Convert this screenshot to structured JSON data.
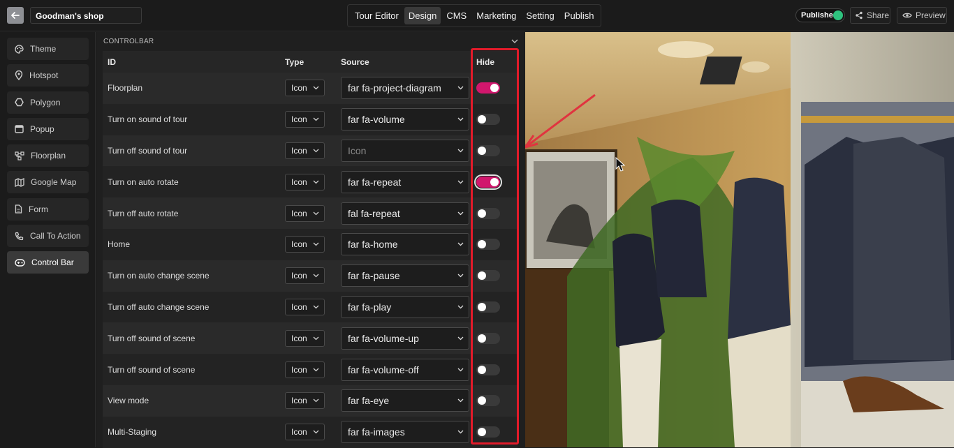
{
  "header": {
    "shop_name": "Goodman's shop",
    "nav": [
      "Tour Editor",
      "Design",
      "CMS",
      "Marketing",
      "Setting",
      "Publish"
    ],
    "active_nav": "Design",
    "published_label": "Published",
    "share_label": "Share",
    "preview_label": "Preview",
    "status_color": "#2ec27e"
  },
  "sidebar": {
    "items": [
      {
        "label": "Theme",
        "icon": "palette-icon"
      },
      {
        "label": "Hotspot",
        "icon": "map-pin-icon"
      },
      {
        "label": "Polygon",
        "icon": "hexagon-icon"
      },
      {
        "label": "Popup",
        "icon": "window-icon"
      },
      {
        "label": "Floorplan",
        "icon": "diagram-icon"
      },
      {
        "label": "Google Map",
        "icon": "map-icon"
      },
      {
        "label": "Form",
        "icon": "document-icon"
      },
      {
        "label": "Call To Action",
        "icon": "phone-icon"
      },
      {
        "label": "Control Bar",
        "icon": "gamepad-icon"
      }
    ],
    "active": "Control Bar"
  },
  "panel": {
    "title": "CONTROLBAR",
    "columns": {
      "id": "ID",
      "type": "Type",
      "source": "Source",
      "hide": "Hide"
    },
    "rows": [
      {
        "id": "Floorplan",
        "type": "Icon",
        "source": "far fa-project-diagram",
        "hide": true
      },
      {
        "id": "Turn on sound of tour",
        "type": "Icon",
        "source": "far fa-volume",
        "hide": false
      },
      {
        "id": "Turn off sound of tour",
        "type": "Icon",
        "source": "Icon",
        "hide": false,
        "placeholder": true
      },
      {
        "id": "Turn on auto rotate",
        "type": "Icon",
        "source": "far fa-repeat",
        "hide": true
      },
      {
        "id": "Turn off auto rotate",
        "type": "Icon",
        "source": "fal fa-repeat",
        "hide": false
      },
      {
        "id": "Home",
        "type": "Icon",
        "source": "far fa-home",
        "hide": false
      },
      {
        "id": "Turn on auto change scene",
        "type": "Icon",
        "source": "far fa-pause",
        "hide": false
      },
      {
        "id": "Turn off auto change scene",
        "type": "Icon",
        "source": "far fa-play",
        "hide": false
      },
      {
        "id": "Turn off sound of scene",
        "type": "Icon",
        "source": "far fa-volume-up",
        "hide": false
      },
      {
        "id": "Turn off sound of scene",
        "type": "Icon",
        "source": "far fa-volume-off",
        "hide": false
      },
      {
        "id": "View mode",
        "type": "Icon",
        "source": "far fa-eye",
        "hide": false
      },
      {
        "id": "Multi-Staging",
        "type": "Icon",
        "source": "far fa-images",
        "hide": false
      }
    ],
    "toggle_on_color": "#d1176d",
    "highlight_color": "#e21b2a"
  }
}
